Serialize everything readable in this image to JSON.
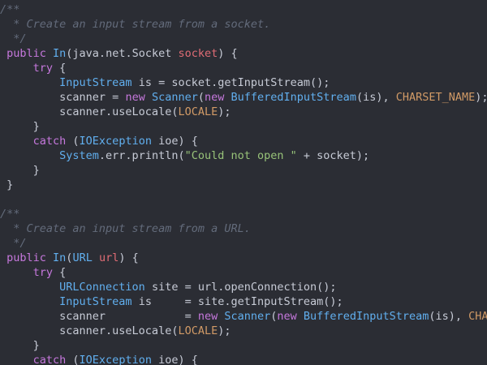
{
  "editor": {
    "colors": {
      "background": "#2b2d34",
      "comment": "#636b7b",
      "keyword": "#c678dd",
      "type": "#61afef",
      "variable": "#e06c75",
      "string": "#98c379",
      "constant": "#d19a66",
      "bracket": "#e5c07b",
      "plain": "#c7cbd6"
    },
    "lines": [
      {
        "indent": "",
        "tokens": [
          {
            "c": "cm",
            "t": "/**"
          }
        ]
      },
      {
        "indent": "",
        "tokens": [
          {
            "c": "cm",
            "t": "  * Create an input stream from a socket."
          }
        ]
      },
      {
        "indent": "",
        "tokens": [
          {
            "c": "cm",
            "t": "  */"
          }
        ]
      },
      {
        "indent": "",
        "tokens": [
          {
            "c": "kw",
            "t": " public "
          },
          {
            "c": "ty",
            "t": "In"
          },
          {
            "c": "pl",
            "t": "(java.net.Socket "
          },
          {
            "c": "vr",
            "t": "socket"
          },
          {
            "c": "pl",
            "t": ") {"
          }
        ]
      },
      {
        "indent": "",
        "tokens": [
          {
            "c": "kw",
            "t": "     try"
          },
          {
            "c": "pl",
            "t": " {"
          }
        ]
      },
      {
        "indent": "",
        "tokens": [
          {
            "c": "ty",
            "t": "         InputStream"
          },
          {
            "c": "pl",
            "t": " is = socket.getInputStream();"
          }
        ]
      },
      {
        "indent": "",
        "tokens": [
          {
            "c": "pl",
            "t": "         scanner = "
          },
          {
            "c": "kw",
            "t": "new "
          },
          {
            "c": "ty",
            "t": "Scanner"
          },
          {
            "c": "pl",
            "t": "("
          },
          {
            "c": "kw",
            "t": "new "
          },
          {
            "c": "ty",
            "t": "BufferedInputStream"
          },
          {
            "c": "pl",
            "t": "(is), "
          },
          {
            "c": "cn",
            "t": "CHARSET_NAME"
          },
          {
            "c": "pl",
            "t": ");"
          }
        ]
      },
      {
        "indent": "",
        "tokens": [
          {
            "c": "pl",
            "t": "         scanner.useLocale("
          },
          {
            "c": "cn",
            "t": "LOCALE"
          },
          {
            "c": "pl",
            "t": ");"
          }
        ]
      },
      {
        "indent": "",
        "tokens": [
          {
            "c": "pl",
            "t": "     }"
          }
        ]
      },
      {
        "indent": "",
        "tokens": [
          {
            "c": "kw",
            "t": "     catch"
          },
          {
            "c": "pl",
            "t": " ("
          },
          {
            "c": "ty",
            "t": "IOException"
          },
          {
            "c": "pl",
            "t": " ioe) {"
          }
        ]
      },
      {
        "indent": "",
        "tokens": [
          {
            "c": "ty",
            "t": "         System"
          },
          {
            "c": "pl",
            "t": ".err.println("
          },
          {
            "c": "st",
            "t": "\"Could not open \""
          },
          {
            "c": "pl",
            "t": " + socket);"
          }
        ]
      },
      {
        "indent": "",
        "tokens": [
          {
            "c": "pl",
            "t": "     }"
          }
        ]
      },
      {
        "indent": "",
        "tokens": [
          {
            "c": "pl",
            "t": " }"
          }
        ]
      },
      {
        "indent": "",
        "tokens": [
          {
            "c": "pl",
            "t": ""
          }
        ]
      },
      {
        "indent": "",
        "tokens": [
          {
            "c": "cm",
            "t": "/**"
          }
        ]
      },
      {
        "indent": "",
        "tokens": [
          {
            "c": "cm",
            "t": "  * Create an input stream from a URL."
          }
        ]
      },
      {
        "indent": "",
        "tokens": [
          {
            "c": "cm",
            "t": "  */"
          }
        ]
      },
      {
        "indent": "",
        "tokens": [
          {
            "c": "kw",
            "t": " public "
          },
          {
            "c": "ty",
            "t": "In"
          },
          {
            "c": "pl",
            "t": "("
          },
          {
            "c": "ty",
            "t": "URL"
          },
          {
            "c": "pl",
            "t": " "
          },
          {
            "c": "vr",
            "t": "url"
          },
          {
            "c": "pl",
            "t": ") {"
          }
        ]
      },
      {
        "indent": "",
        "tokens": [
          {
            "c": "kw",
            "t": "     try"
          },
          {
            "c": "pl",
            "t": " {"
          }
        ]
      },
      {
        "indent": "",
        "tokens": [
          {
            "c": "ty",
            "t": "         URLConnection"
          },
          {
            "c": "pl",
            "t": " site = url.openConnection();"
          }
        ]
      },
      {
        "indent": "",
        "tokens": [
          {
            "c": "ty",
            "t": "         InputStream"
          },
          {
            "c": "pl",
            "t": " is     = site.getInputStream();"
          }
        ]
      },
      {
        "indent": "",
        "tokens": [
          {
            "c": "pl",
            "t": "         scanner            = "
          },
          {
            "c": "kw",
            "t": "new "
          },
          {
            "c": "ty",
            "t": "Scanner"
          },
          {
            "c": "pl",
            "t": "("
          },
          {
            "c": "kw",
            "t": "new "
          },
          {
            "c": "ty",
            "t": "BufferedInputStream"
          },
          {
            "c": "pl",
            "t": "(is), "
          },
          {
            "c": "cn",
            "t": "CHARSE"
          }
        ]
      },
      {
        "indent": "",
        "tokens": [
          {
            "c": "pl",
            "t": "         scanner.useLocale("
          },
          {
            "c": "cn",
            "t": "LOCALE"
          },
          {
            "c": "pl",
            "t": ");"
          }
        ]
      },
      {
        "indent": "",
        "tokens": [
          {
            "c": "pl",
            "t": "     }"
          }
        ]
      },
      {
        "indent": "",
        "tokens": [
          {
            "c": "kw",
            "t": "     catch"
          },
          {
            "c": "pl",
            "t": " ("
          },
          {
            "c": "ty",
            "t": "IOException"
          },
          {
            "c": "pl",
            "t": " ioe) {"
          }
        ]
      }
    ]
  }
}
